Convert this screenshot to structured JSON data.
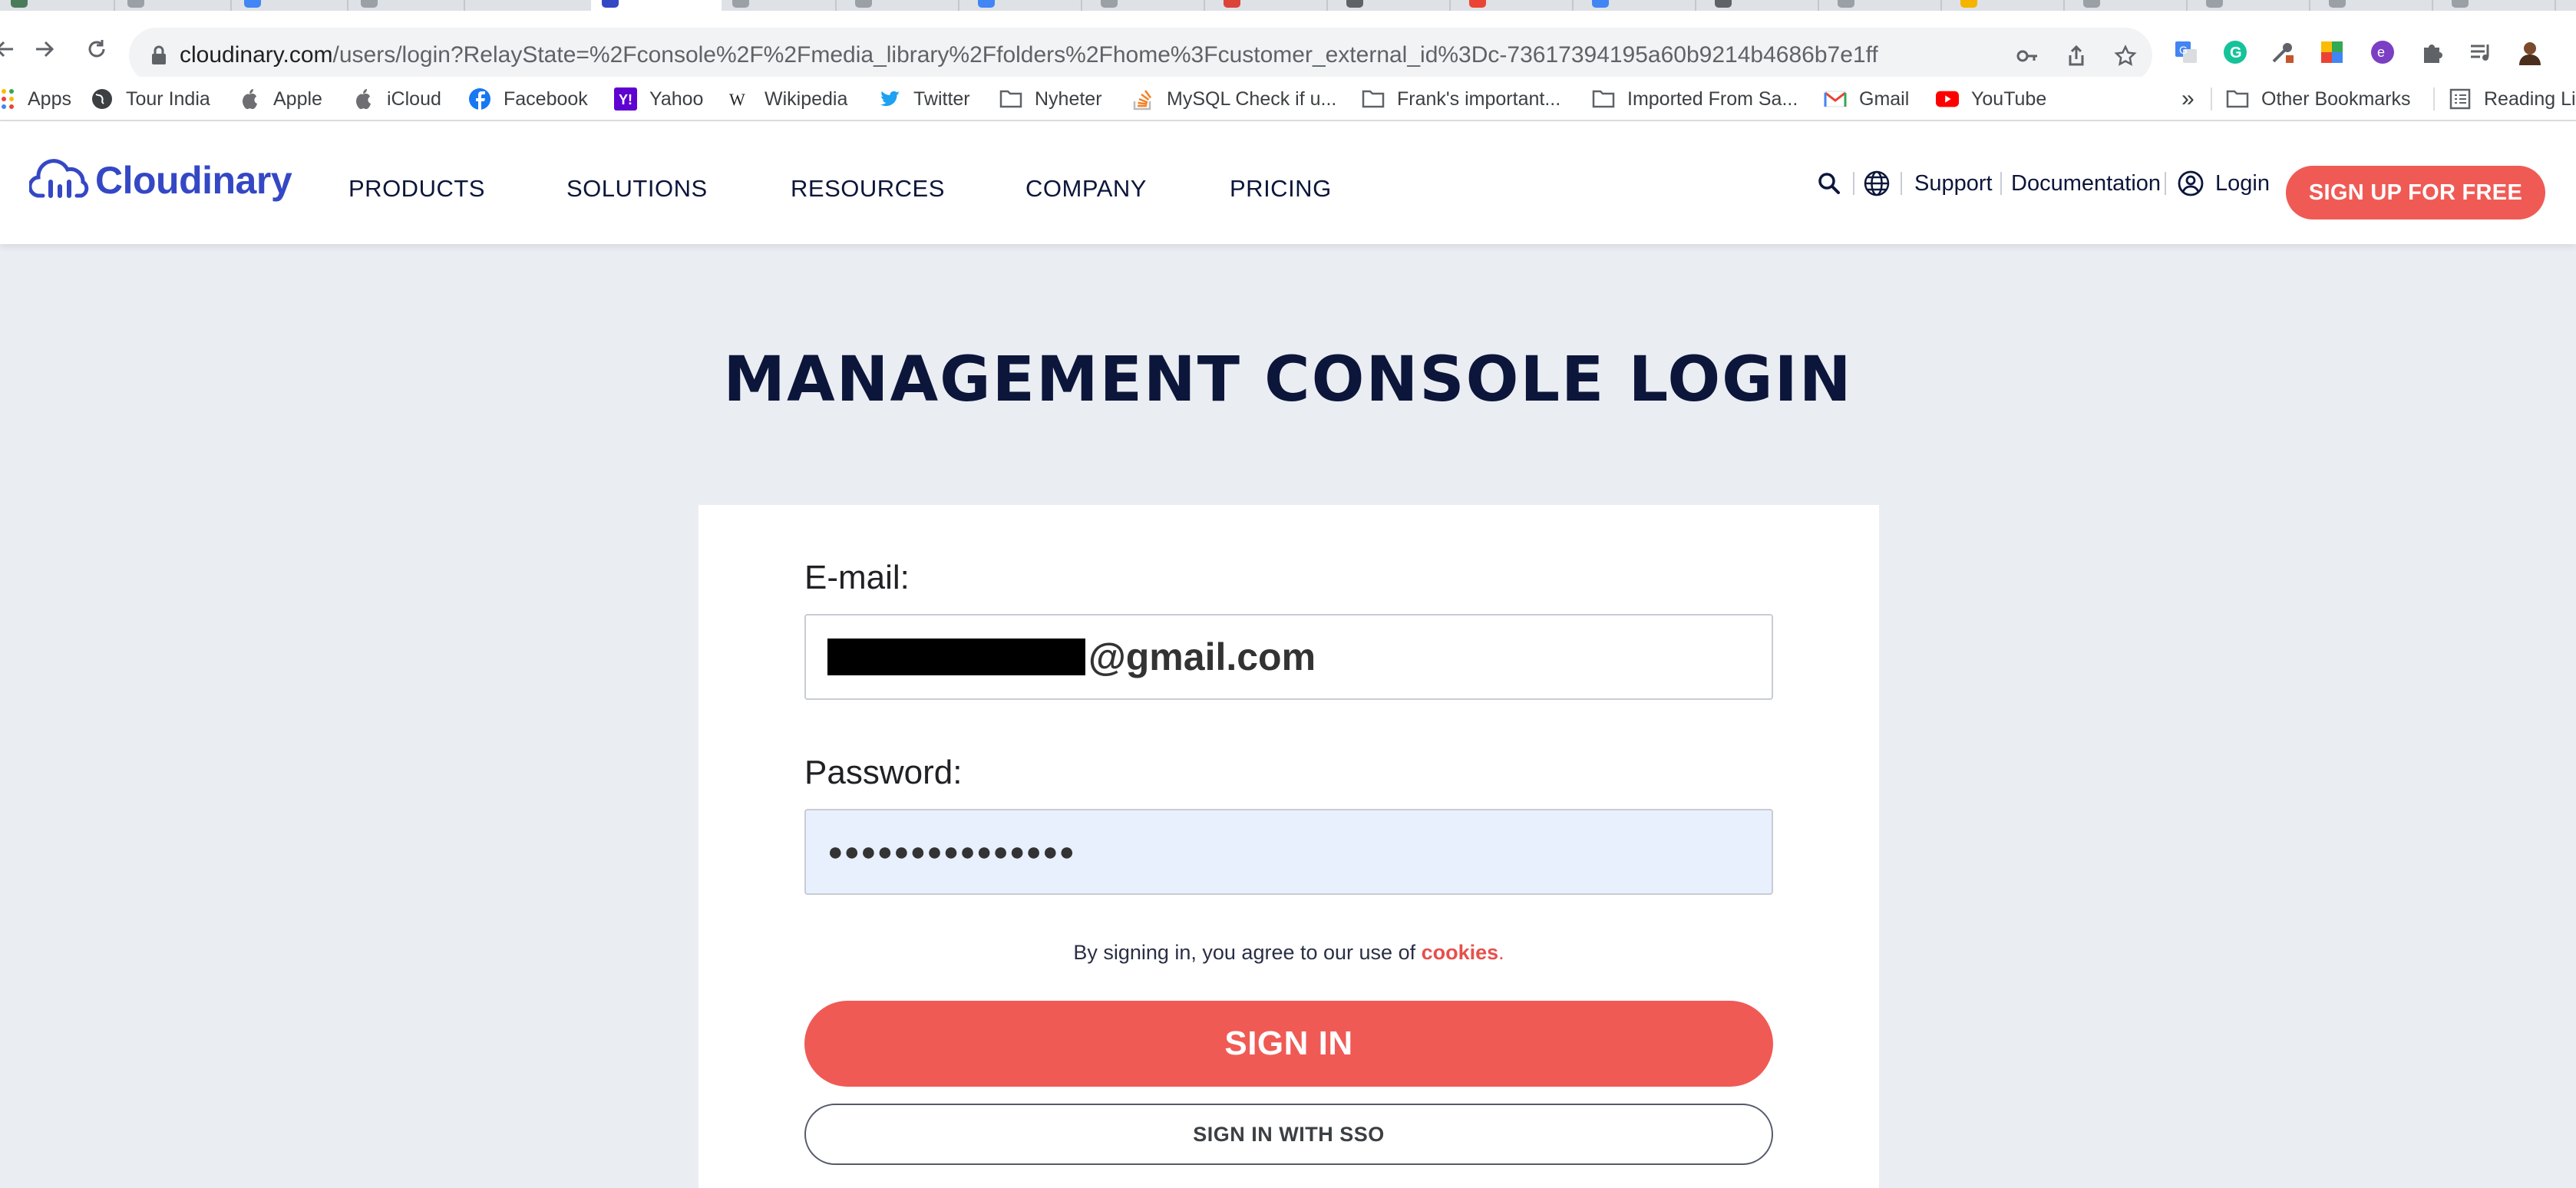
{
  "browser": {
    "url_host": "cloudinary.com",
    "url_path": "/users/login?RelayState=%2Fconsole%2F%2Fmedia_library%2Ffolders%2Fhome%3Fcustomer_external_id%3Dc-73617394195a60b9214b4686b7e1ff",
    "bookmarks": [
      {
        "label": "Apps",
        "icon": "apps-grid-icon"
      },
      {
        "label": "Tour India",
        "icon": "globe-icon"
      },
      {
        "label": "Apple",
        "icon": "apple-icon"
      },
      {
        "label": "iCloud",
        "icon": "apple-icon"
      },
      {
        "label": "Facebook",
        "icon": "facebook-icon"
      },
      {
        "label": "Yahoo",
        "icon": "yahoo-icon"
      },
      {
        "label": "Wikipedia",
        "icon": "wikipedia-icon"
      },
      {
        "label": "Twitter",
        "icon": "twitter-icon"
      },
      {
        "label": "Nyheter",
        "icon": "folder-icon"
      },
      {
        "label": "MySQL Check if u...",
        "icon": "stackoverflow-icon"
      },
      {
        "label": "Frank's important...",
        "icon": "folder-icon"
      },
      {
        "label": "Imported From Sa...",
        "icon": "folder-icon"
      },
      {
        "label": "Gmail",
        "icon": "gmail-icon"
      },
      {
        "label": "YouTube",
        "icon": "youtube-icon"
      }
    ],
    "overflow": "»",
    "other_bookmarks": "Other Bookmarks",
    "reading_list": "Reading Li"
  },
  "header": {
    "brand": "Cloudinary",
    "nav": [
      "PRODUCTS",
      "SOLUTIONS",
      "RESOURCES",
      "COMPANY",
      "PRICING"
    ],
    "support": "Support",
    "documentation": "Documentation",
    "login": "Login",
    "signup": "SIGN UP FOR FREE"
  },
  "login": {
    "title": "MANAGEMENT CONSOLE LOGIN",
    "email_label": "E-mail:",
    "email_value": "@gmail.com",
    "password_label": "Password:",
    "password_value": "●●●●●●●●●●●●●●●",
    "agree_text": "By signing in, you agree to our use of ",
    "agree_link": "cookies",
    "agree_end": ".",
    "signin": "SIGN IN",
    "sso": "SIGN IN WITH SSO"
  },
  "colors": {
    "brand_blue": "#3448c5",
    "accent_coral": "#f05a55",
    "navy_text": "#0c163b",
    "page_bg": "#eaedf2",
    "autofill_bg": "#e8f0fe"
  }
}
